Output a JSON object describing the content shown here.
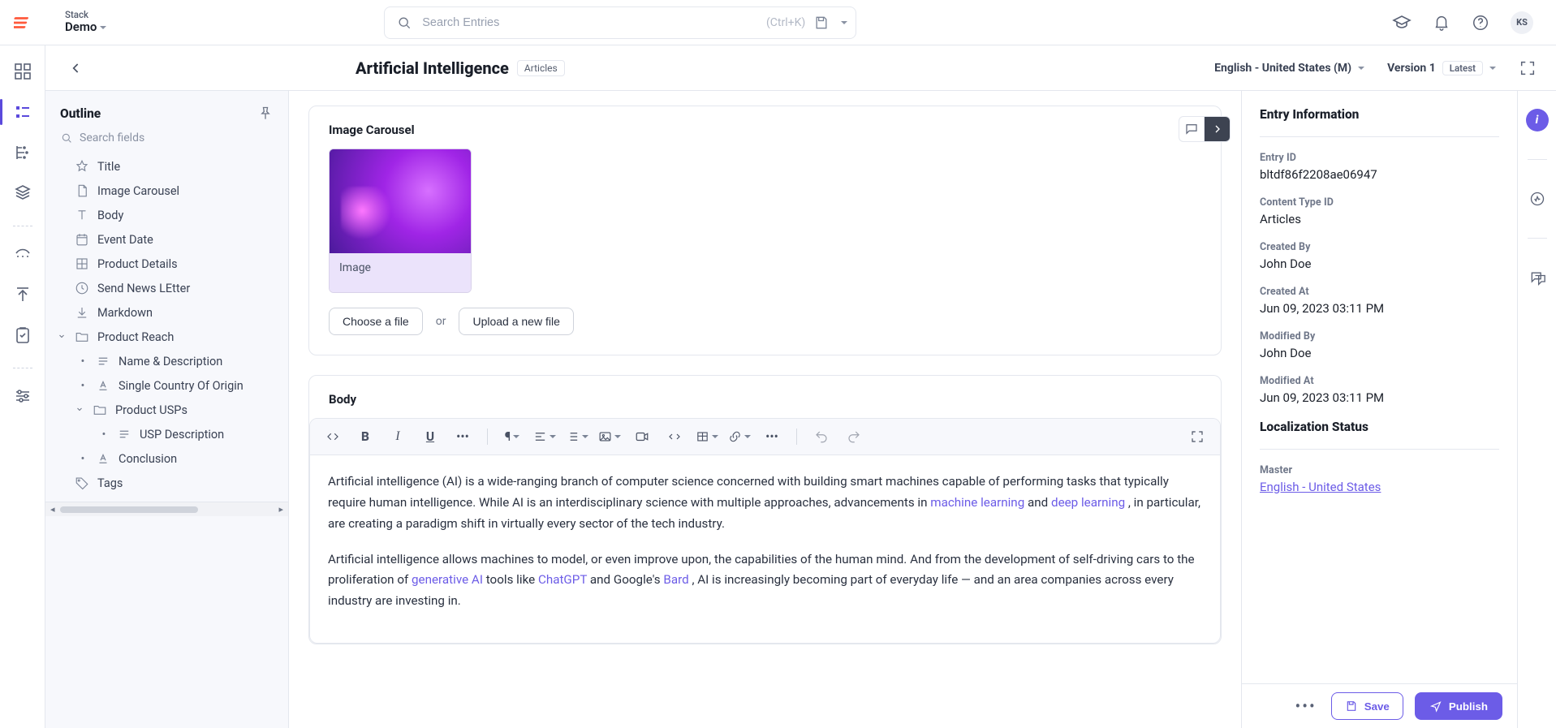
{
  "topbar": {
    "stack_label": "Stack",
    "stack_name": "Demo",
    "search_placeholder": "Search Entries",
    "search_shortcut": "(Ctrl+K)",
    "avatar_initials": "KS"
  },
  "header": {
    "entry_title": "Artificial Intelligence",
    "content_type_chip": "Articles",
    "locale": "English - United States (M)",
    "version": "Version 1",
    "version_chip": "Latest"
  },
  "outline": {
    "title": "Outline",
    "search_placeholder": "Search fields",
    "items": [
      {
        "label": "Title",
        "icon": "star"
      },
      {
        "label": "Image Carousel",
        "icon": "file"
      },
      {
        "label": "Body",
        "icon": "text"
      },
      {
        "label": "Event Date",
        "icon": "calendar"
      },
      {
        "label": "Product Details",
        "icon": "grid"
      },
      {
        "label": "Send News LEtter",
        "icon": "clock"
      },
      {
        "label": "Markdown",
        "icon": "download"
      },
      {
        "label": "Product Reach",
        "icon": "folder",
        "expandable": true,
        "expanded": true
      },
      {
        "label": "Name & Description",
        "icon": "lines",
        "depth": 1,
        "bullet": true
      },
      {
        "label": "Single Country Of Origin",
        "icon": "underline-a",
        "depth": 1,
        "bullet": true
      },
      {
        "label": "Product USPs",
        "icon": "folder",
        "depth": 1,
        "expandable": true,
        "expanded": true
      },
      {
        "label": "USP Description",
        "icon": "lines",
        "depth": 2,
        "bullet": true
      },
      {
        "label": "Conclusion",
        "icon": "underline-a",
        "depth": 1,
        "bullet": true
      },
      {
        "label": "Tags",
        "icon": "tag"
      }
    ]
  },
  "canvas": {
    "image_carousel": {
      "label": "Image Carousel",
      "tile_caption": "Image",
      "choose_label": "Choose a file",
      "or_text": "or",
      "upload_label": "Upload a new file"
    },
    "body": {
      "label": "Body",
      "p1_a": "Artificial intelligence (AI) is a wide-ranging branch of computer science concerned with building smart machines capable of performing tasks that typically require human intelligence. While AI is an interdisciplinary science with multiple approaches, advancements in ",
      "p1_link1": "machine learning",
      "p1_b": " and ",
      "p1_link2": "deep learning",
      "p1_c": ", in particular, are creating a paradigm shift in virtually every sector of the tech industry.",
      "p2_a": "Artificial intelligence allows machines to model, or even improve upon, the capabilities of the human mind. And from the development of self-driving cars to the proliferation of ",
      "p2_link1": "generative AI",
      "p2_b": " tools like ",
      "p2_link2": "ChatGPT",
      "p2_c": " and Google's ",
      "p2_link3": "Bard",
      "p2_d": ", AI is increasingly becoming part of everyday life — and an area companies across every industry are investing in."
    }
  },
  "info": {
    "title": "Entry Information",
    "entry_id_label": "Entry ID",
    "entry_id": "bltdf86f2208ae06947",
    "content_type_label": "Content Type ID",
    "content_type": "Articles",
    "created_by_label": "Created By",
    "created_by": "John Doe",
    "created_at_label": "Created At",
    "created_at": "Jun 09, 2023 03:11 PM",
    "modified_by_label": "Modified By",
    "modified_by": "John Doe",
    "modified_at_label": "Modified At",
    "modified_at": "Jun 09, 2023 03:11 PM",
    "loc_status_title": "Localization Status",
    "master_label": "Master",
    "master_value": "English - United States",
    "save_label": "Save",
    "publish_label": "Publish"
  }
}
